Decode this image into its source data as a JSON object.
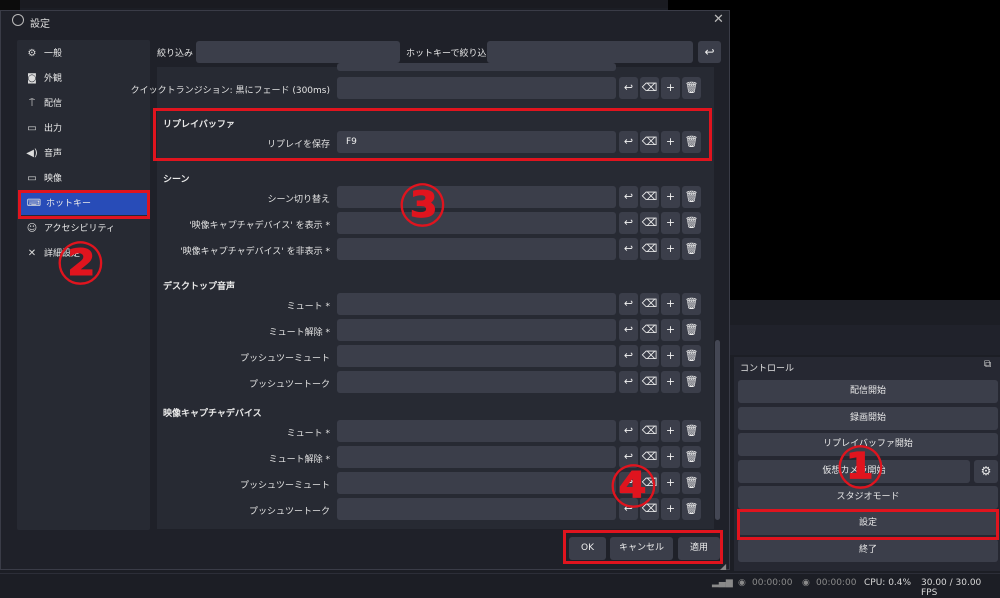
{
  "dialog": {
    "title": "設定",
    "close_icon": "close-icon",
    "filter_label": "絞り込み",
    "hotkey_filter_label": "ホットキーで絞り込み",
    "reset_icon": "undo-icon"
  },
  "sidebar": {
    "items": [
      {
        "label": "一般",
        "icon": "gear-icon"
      },
      {
        "label": "外観",
        "icon": "appearance-icon"
      },
      {
        "label": "配信",
        "icon": "broadcast-icon"
      },
      {
        "label": "出力",
        "icon": "output-icon"
      },
      {
        "label": "音声",
        "icon": "speaker-icon"
      },
      {
        "label": "映像",
        "icon": "monitor-icon"
      },
      {
        "label": "ホットキー",
        "icon": "keyboard-icon"
      },
      {
        "label": "アクセシビリティ",
        "icon": "accessibility-icon"
      },
      {
        "label": "詳細設定",
        "icon": "tools-icon"
      }
    ],
    "active": "ホットキー"
  },
  "hotkeys": {
    "transition_row": {
      "label": "クイックトランジション: 黒にフェード (300ms)",
      "value": ""
    },
    "replay_section": {
      "title": "リプレイバッファ",
      "rows": [
        {
          "label": "リプレイを保存",
          "value": "F9"
        }
      ]
    },
    "scene_section": {
      "title": "シーン",
      "rows": [
        {
          "label": "シーン切り替え",
          "value": ""
        },
        {
          "label": "'映像キャプチャデバイス' を表示 *",
          "value": ""
        },
        {
          "label": "'映像キャプチャデバイス' を非表示 *",
          "value": ""
        }
      ]
    },
    "desktop_section": {
      "title": "デスクトップ音声",
      "rows": [
        {
          "label": "ミュート *",
          "value": ""
        },
        {
          "label": "ミュート解除 *",
          "value": ""
        },
        {
          "label": "プッシュツーミュート",
          "value": ""
        },
        {
          "label": "プッシュツートーク",
          "value": ""
        }
      ]
    },
    "video_section": {
      "title": "映像キャプチャデバイス",
      "rows": [
        {
          "label": "ミュート *",
          "value": ""
        },
        {
          "label": "ミュート解除 *",
          "value": ""
        },
        {
          "label": "プッシュツーミュート",
          "value": ""
        },
        {
          "label": "プッシュツートーク",
          "value": ""
        }
      ]
    }
  },
  "buttons": {
    "ok": "OK",
    "cancel": "キャンセル",
    "apply": "適用"
  },
  "controls": {
    "title": "コントロール",
    "buttons": [
      "配信開始",
      "録画開始",
      "リプレイバッファ開始",
      "仮想カメラ開始",
      "スタジオモード",
      "設定",
      "終了"
    ]
  },
  "status": {
    "rec_time": "00:00:00",
    "stream_time": "00:00:00",
    "cpu": "CPU: 0.4%",
    "fps": "30.00 / 30.00 FPS"
  },
  "annotations": [
    "①",
    "②",
    "③",
    "④"
  ],
  "colors": {
    "highlight": "#e0141e",
    "active": "#284cb8"
  }
}
